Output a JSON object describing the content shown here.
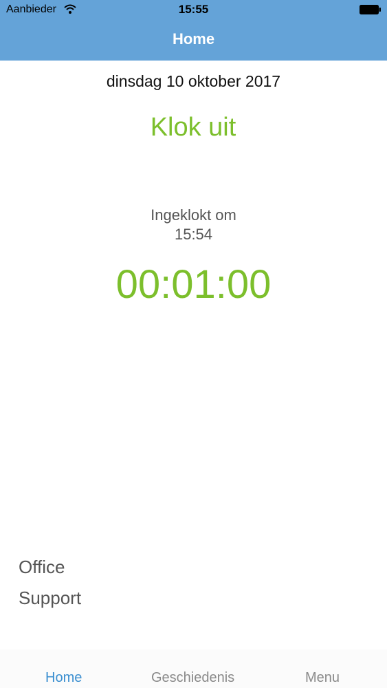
{
  "status_bar": {
    "carrier": "Aanbieder",
    "time": "15:55"
  },
  "nav": {
    "title": "Home"
  },
  "main": {
    "date": "dinsdag 10 oktober 2017",
    "clock_out_label": "Klok uit",
    "clocked_in_label": "Ingeklokt om",
    "clocked_in_time": "15:54",
    "elapsed": "00:01:00",
    "office_line1": "Office",
    "office_line2": "Support"
  },
  "tabs": [
    {
      "label": "Home",
      "active": true
    },
    {
      "label": "Geschiedenis",
      "active": false
    },
    {
      "label": "Menu",
      "active": false
    }
  ],
  "icons": {
    "wifi": "wifi-icon",
    "battery": "battery-icon"
  },
  "colors": {
    "nav_bar": "#64a3d8",
    "accent_green": "#7cbf2c",
    "tab_active": "#3b8fd0",
    "tab_inactive": "#8a8a8a"
  }
}
